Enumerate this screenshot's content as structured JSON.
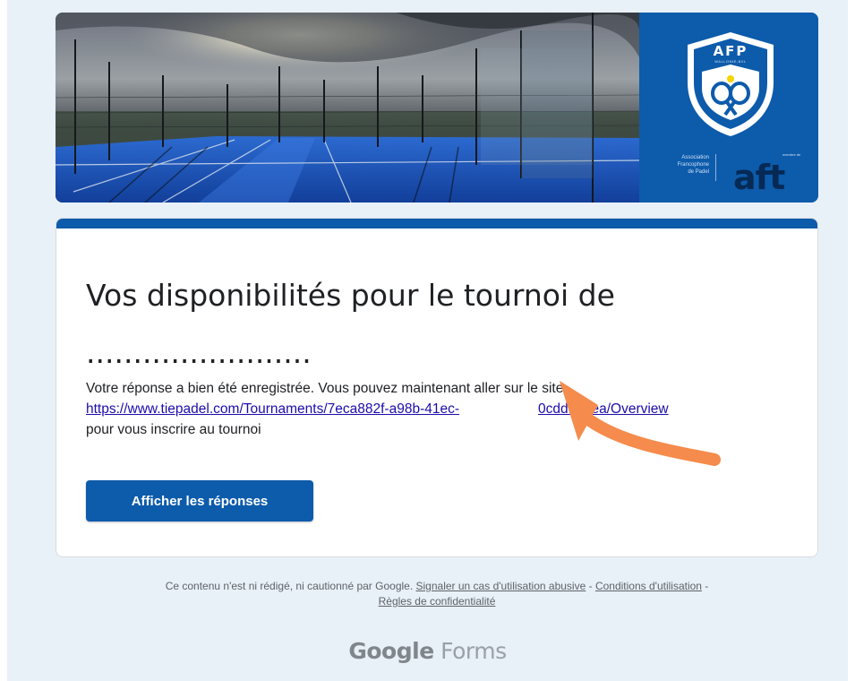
{
  "banner": {
    "logo_letters": "AFP",
    "logo_sub": "WALLONIE-BXL",
    "assoc_line1": "Association",
    "assoc_line2": "Francophone",
    "assoc_line3": "de Padel",
    "partner_small": "membre de",
    "partner_logo": "aft",
    "colors": {
      "brand_blue": "#0d5bab",
      "logo_dark": "#062a55"
    }
  },
  "card": {
    "title": "Vos disponibilités pour le tournoi de ........................",
    "message_before": "Votre réponse a bien été enregistrée. Vous pouvez maintenant aller sur le site",
    "link_text": "https://www.tiepadel.com/Tournaments/7eca882f-a98b-41ec-",
    "link_tail": "0cddf01fea/Overview",
    "message_after": "pour vous inscrire au tournoi",
    "view_responses_label": "Afficher les réponses"
  },
  "annotation": {
    "arrow_color": "#f58b4c"
  },
  "footer": {
    "disclaimer": "Ce contenu n'est ni rédigé, ni cautionné par Google.",
    "report_abuse": "Signaler un cas d'utilisation abusive",
    "sep1": " - ",
    "terms": "Conditions d'utilisation",
    "sep2": " -",
    "privacy": "Règles de confidentialité",
    "brand_google": "Google",
    "brand_forms": "Forms"
  }
}
